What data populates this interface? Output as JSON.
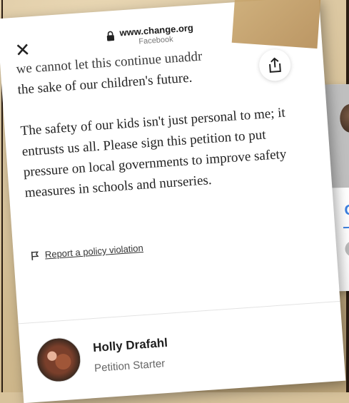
{
  "browser": {
    "url": "www.change.org",
    "source": "Facebook",
    "close_icon": "close-icon",
    "lock_icon": "lock-icon"
  },
  "share": {
    "icon": "share-icon"
  },
  "petition": {
    "cut_line": "we cannot let this continue unaddr",
    "para1_end": "the sake of our children's future.",
    "para2": "The safety of our kids isn't just personal to me; it entrusts us all. Please sign this petition to put pressure on local governments to improve safety measures in schools and nurseries."
  },
  "report": {
    "icon": "flag-icon",
    "label": "Report a policy violation"
  },
  "starter": {
    "name": "Holly Drafahl",
    "role": "Petition Starter"
  },
  "colors": {
    "background": "#d8c39c",
    "card": "#ffffff",
    "text": "#232323",
    "accent_blue": "#3b7fe0"
  }
}
